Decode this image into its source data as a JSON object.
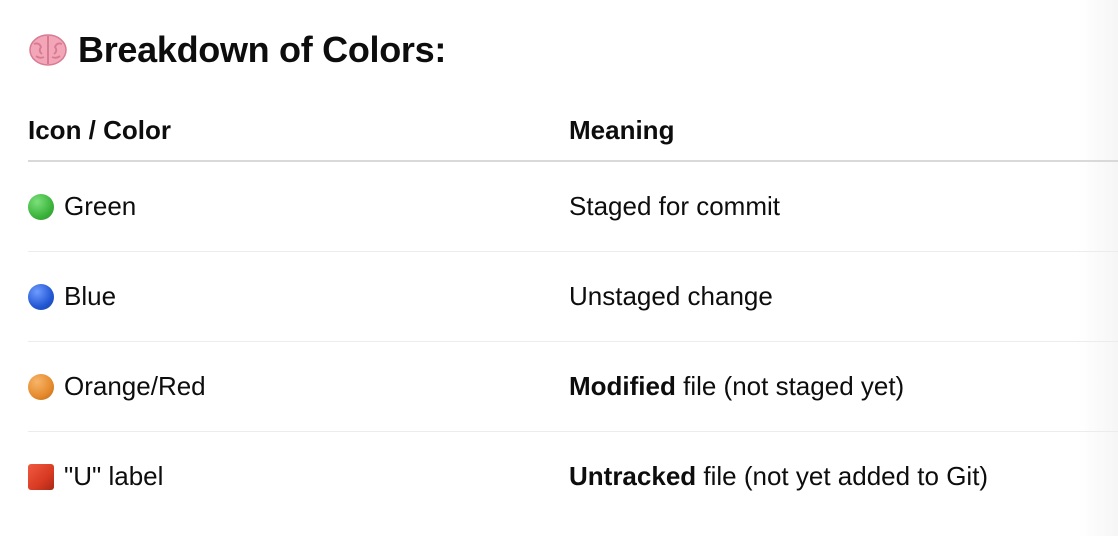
{
  "heading": {
    "icon": "brain-icon",
    "title": "Breakdown of Colors:"
  },
  "table": {
    "headers": [
      "Icon / Color",
      "Meaning"
    ],
    "rows": [
      {
        "icon": "green-circle-icon",
        "icon_color": "#3cb43c",
        "label": "Green",
        "meaning_bold": "",
        "meaning_rest": "Staged for commit"
      },
      {
        "icon": "blue-circle-icon",
        "icon_color": "#2358d4",
        "label": "Blue",
        "meaning_bold": "",
        "meaning_rest": "Unstaged change"
      },
      {
        "icon": "orange-circle-icon",
        "icon_color": "#e58a2c",
        "label": "Orange/Red",
        "meaning_bold": "Modified",
        "meaning_rest": " file (not staged yet)"
      },
      {
        "icon": "red-square-icon",
        "icon_color": "#d83a22",
        "label": "\"U\" label",
        "meaning_bold": "Untracked",
        "meaning_rest": " file (not yet added to Git)"
      }
    ]
  }
}
